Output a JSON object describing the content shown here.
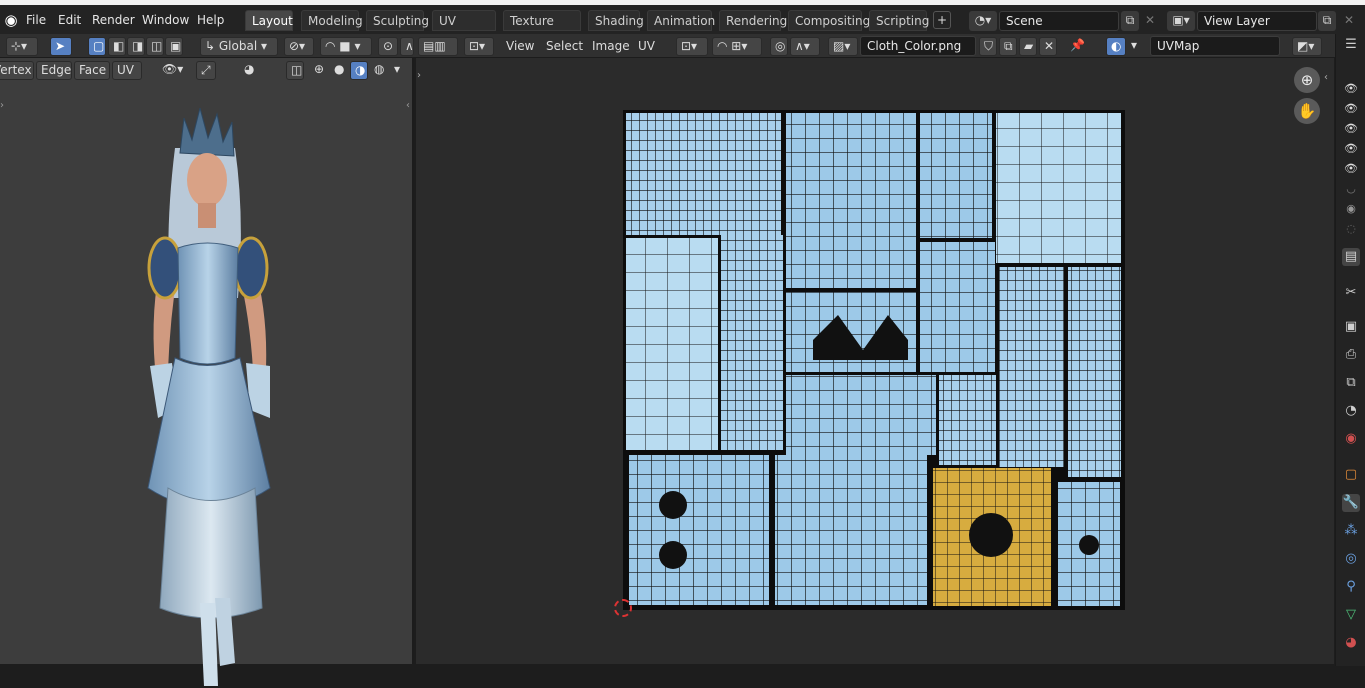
{
  "app": {
    "logo_icon": "blender-logo-icon"
  },
  "menu": [
    "File",
    "Edit",
    "Render",
    "Window",
    "Help"
  ],
  "workspace_tabs": [
    "Layout",
    "Modeling",
    "Sculpting",
    "UV Editing",
    "Texture Paint",
    "Shading",
    "Animation",
    "Rendering",
    "Compositing",
    "Scripting"
  ],
  "active_tab": "Layout",
  "add_tab_label": "+",
  "scene": {
    "label": "Scene"
  },
  "view_layer": {
    "label": "View Layer"
  },
  "viewport_header": {
    "transform_orientation": "Global",
    "select_modes": [
      "Vertex",
      "Edge",
      "Face",
      "UV"
    ]
  },
  "uv_header": {
    "menus": [
      "View",
      "Select",
      "Image",
      "UV"
    ],
    "image_name": "Cloth_Color.png",
    "uv_map": "UVMap"
  },
  "colors": {
    "accent": "#5680c2",
    "texture_blue": "#9cc8e6",
    "texture_gold": "#d7ac3f"
  }
}
